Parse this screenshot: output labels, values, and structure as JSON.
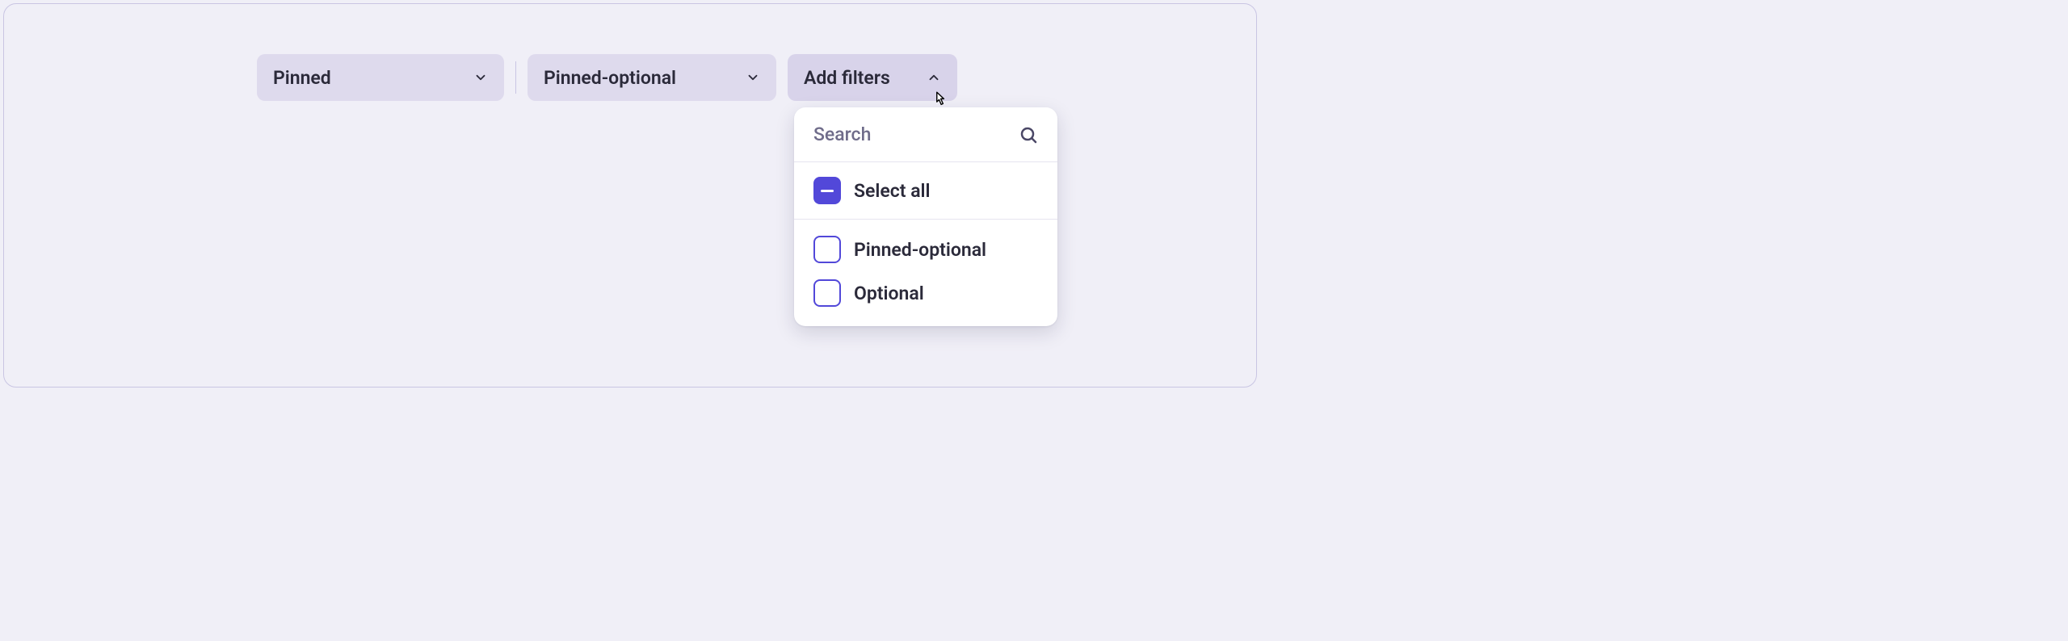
{
  "filters": {
    "pinned_label": "Pinned",
    "pinned_optional_label": "Pinned-optional",
    "add_filters_label": "Add filters"
  },
  "popover": {
    "search_placeholder": "Search",
    "select_all_label": "Select all",
    "options": [
      {
        "label": "Pinned-optional",
        "checked": false
      },
      {
        "label": "Optional",
        "checked": false
      }
    ]
  },
  "colors": {
    "accent": "#5248d9",
    "pill_bg": "#dedaed",
    "panel_bg": "#f0eff7",
    "text": "#2b2a3a",
    "muted": "#6f6c8a"
  }
}
